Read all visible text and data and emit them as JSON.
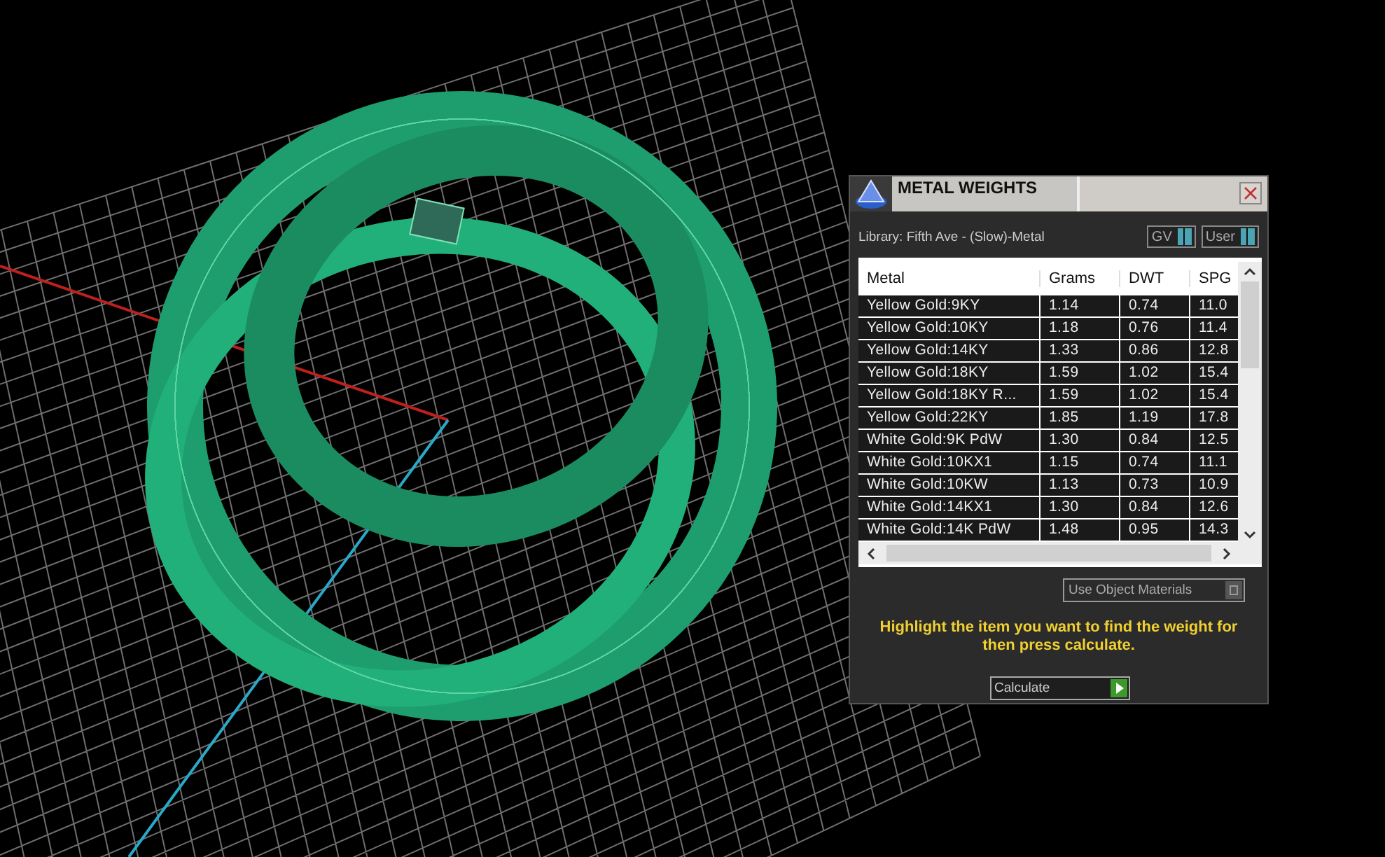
{
  "window": {
    "title": "METAL WEIGHTS"
  },
  "library": "Library: Fifth Ave - (Slow)-Metal",
  "toggles": [
    {
      "label": "GV",
      "on": true
    },
    {
      "label": "User",
      "on": true
    }
  ],
  "table": {
    "columns": [
      "Metal",
      "Grams",
      "DWT",
      "SPG"
    ],
    "rows": [
      {
        "cells": [
          "Yellow Gold:9KY",
          "1.14",
          "0.74",
          "11.0"
        ],
        "selected": false
      },
      {
        "cells": [
          "Yellow Gold:10KY",
          "1.18",
          "0.76",
          "11.4"
        ],
        "selected": false
      },
      {
        "cells": [
          "Yellow Gold:14KY",
          "1.33",
          "0.86",
          "12.8"
        ],
        "selected": false
      },
      {
        "cells": [
          "Yellow Gold:18KY",
          "1.59",
          "1.02",
          "15.4"
        ],
        "selected": false
      },
      {
        "cells": [
          "Yellow Gold:18KY R...",
          "1.59",
          "1.02",
          "15.4"
        ],
        "selected": false
      },
      {
        "cells": [
          "Yellow Gold:22KY",
          "1.85",
          "1.19",
          "17.8"
        ],
        "selected": false
      },
      {
        "cells": [
          "White Gold:9K PdW",
          "1.30",
          "0.84",
          "12.5"
        ],
        "selected": false
      },
      {
        "cells": [
          "White Gold:10KX1",
          "1.15",
          "0.74",
          "11.1"
        ],
        "selected": false
      },
      {
        "cells": [
          "White Gold:10KW",
          "1.13",
          "0.73",
          "10.9"
        ],
        "selected": false
      },
      {
        "cells": [
          "White Gold:14KX1",
          "1.30",
          "0.84",
          "12.6"
        ],
        "selected": false
      },
      {
        "cells": [
          "White Gold:14K PdW",
          "1.48",
          "0.95",
          "14.3"
        ],
        "selected": false
      }
    ]
  },
  "use_object_materials": {
    "label": "Use Object Materials",
    "on": false
  },
  "instruction": "Highlight the item you want to find the weight for then press calculate.",
  "calculate_button": "Calculate"
}
